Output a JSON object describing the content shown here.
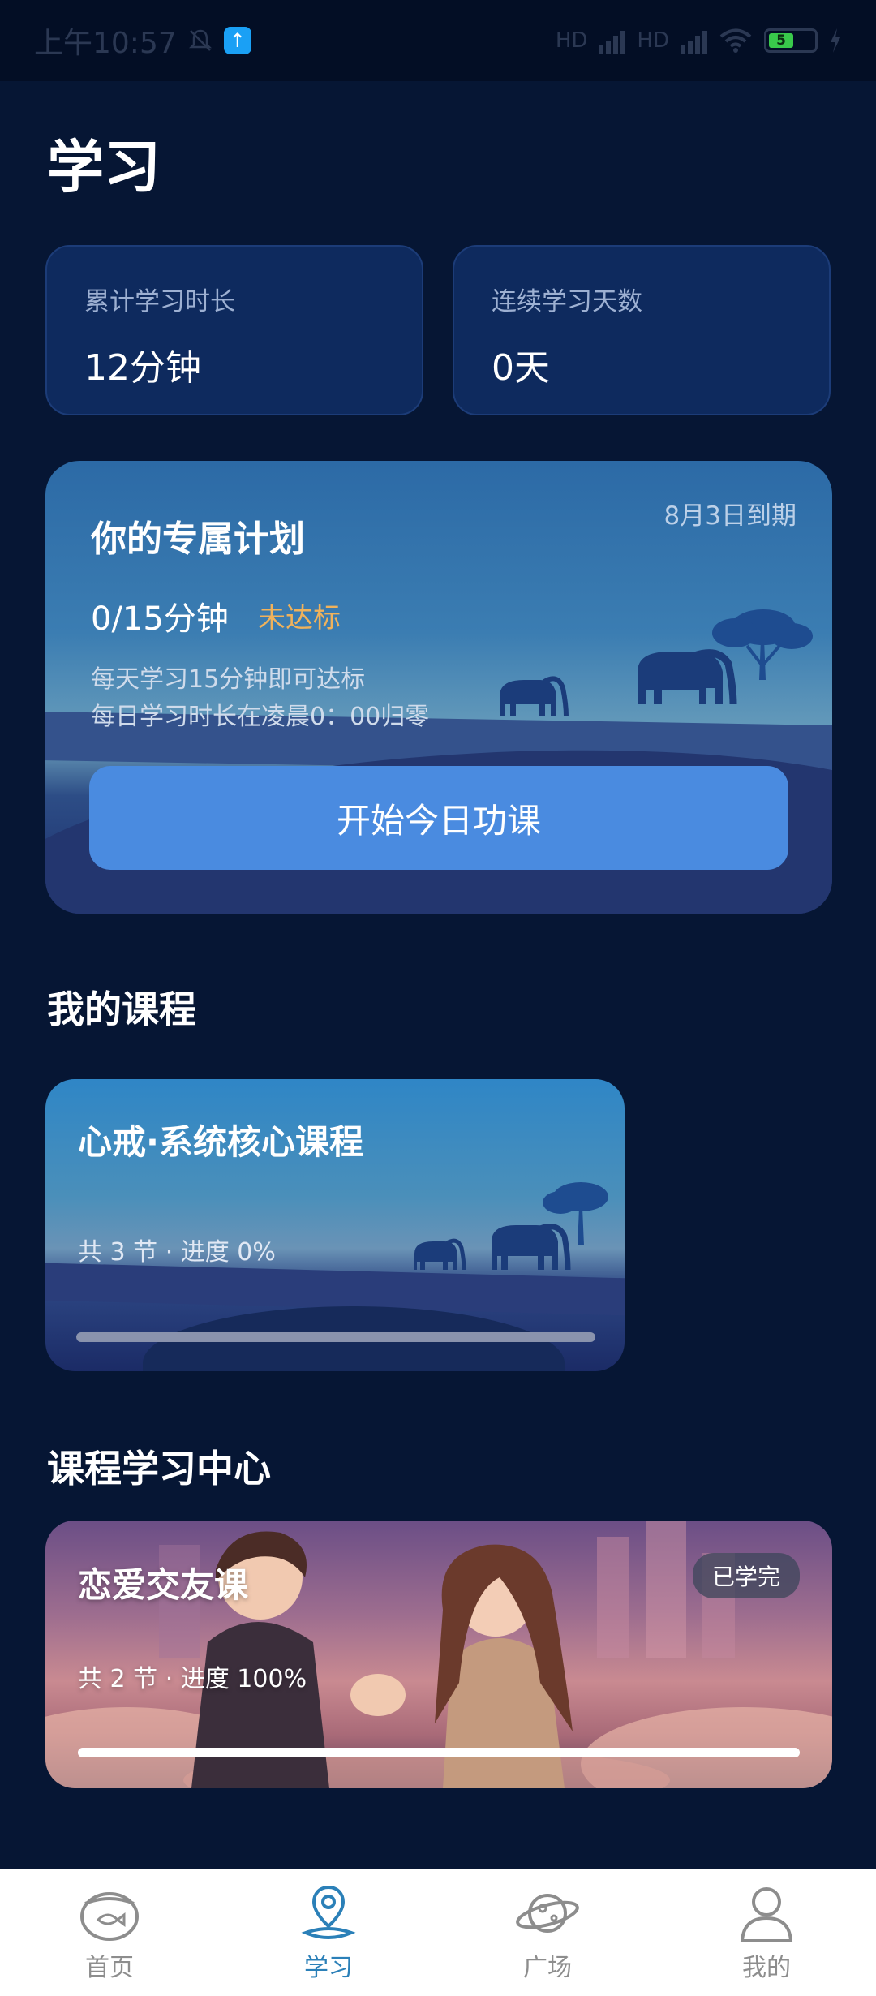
{
  "status_bar": {
    "time": "上午10:57",
    "network_label": "HD",
    "battery_level": "5"
  },
  "page": {
    "title": "学习"
  },
  "stats": [
    {
      "label": "累计学习时长",
      "value": "12分钟"
    },
    {
      "label": "连续学习天数",
      "value": "0天"
    }
  ],
  "plan": {
    "title": "你的专属计划",
    "deadline": "8月3日到期",
    "progress": "0/15分钟",
    "status": "未达标",
    "rule_line1": "每天学习15分钟即可达标",
    "rule_line2": "每日学习时长在凌晨0：00归零",
    "start_button": "开始今日功课"
  },
  "my_courses": {
    "section_title": "我的课程",
    "items": [
      {
        "title": "心戒·系统核心课程",
        "meta": "共 3 节 · 进度 0%",
        "progress": 0
      }
    ]
  },
  "learning_center": {
    "section_title": "课程学习中心",
    "items": [
      {
        "title": "恋爱交友课",
        "badge": "已学完",
        "meta": "共 2 节 · 进度 100%",
        "progress": 1
      }
    ]
  },
  "tabs": [
    {
      "label": "首页",
      "icon": "fishbowl-icon",
      "active": false
    },
    {
      "label": "学习",
      "icon": "location-pin-icon",
      "active": true
    },
    {
      "label": "广场",
      "icon": "planet-icon",
      "active": false
    },
    {
      "label": "我的",
      "icon": "person-icon",
      "active": false
    }
  ],
  "colors": {
    "background": "#061634",
    "stat_card": "#0e2a5e",
    "primary_button": "#4a8be0",
    "warning_text": "#f0b25b",
    "active_tab": "#2b80b8",
    "inactive_tab": "#8d8d8d"
  }
}
